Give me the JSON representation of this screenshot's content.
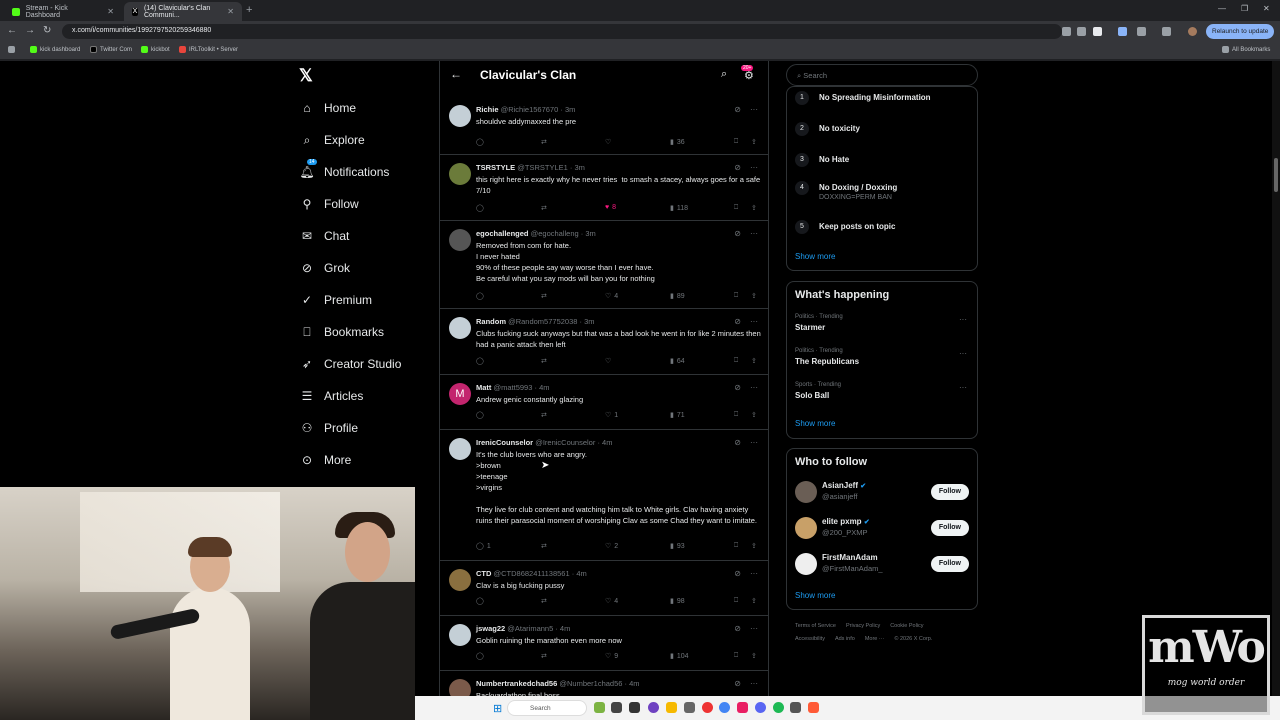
{
  "browser": {
    "tabs": [
      {
        "title": "Stream - Kick Dashboard"
      },
      {
        "title": "(14) Clavicular's Clan Communi..."
      }
    ],
    "url": "x.com/i/communities/1992797520259346880",
    "relaunch_label": "Relaunch to update",
    "bookmarks": [
      "kick dashboard",
      "Twitter Com",
      "kickbot",
      "IRLToolkit • Server"
    ],
    "all_bookmarks_label": "All Bookmarks"
  },
  "sidebar": {
    "notification_count": "14",
    "items": [
      {
        "label": "Home"
      },
      {
        "label": "Explore"
      },
      {
        "label": "Notifications"
      },
      {
        "label": "Follow"
      },
      {
        "label": "Chat"
      },
      {
        "label": "Grok"
      },
      {
        "label": "Premium"
      },
      {
        "label": "Bookmarks"
      },
      {
        "label": "Creator Studio"
      },
      {
        "label": "Articles"
      },
      {
        "label": "Profile"
      },
      {
        "label": "More"
      }
    ]
  },
  "feed": {
    "title": "Clavicular's Clan",
    "header_badge": "20+",
    "tweets": [
      {
        "name": "Richie",
        "handle": "@Richie1567670",
        "time": "· 3m",
        "text": "shouldve addymaxxed the pre",
        "replies": "",
        "likes": "",
        "views": "36"
      },
      {
        "name": "TSRSTYLE",
        "handle": "@TSRSTYLE1",
        "time": "· 3m",
        "text": "this right here is exactly why he never tries  to smash a stacey, always goes for a safe 7/10",
        "replies": "",
        "likes": "8",
        "views": "118"
      },
      {
        "name": "egochallenged",
        "handle": "@egochalleng",
        "time": "· 3m",
        "text": "Removed from com for hate.\nI never hated\n90% of these people say way worse than I ever have.\nBe careful what you say mods will ban you for nothing",
        "replies": "",
        "likes": "4",
        "views": "89"
      },
      {
        "name": "Random",
        "handle": "@Random57752038",
        "time": "· 3m",
        "text": "Clubs fucking suck anyways but that was a bad look he went in for like 2 minutes then had a panic attack then left",
        "replies": "",
        "likes": "",
        "views": "64"
      },
      {
        "name": "Matt",
        "handle": "@matt5993",
        "time": "· 4m",
        "text": "Andrew genic constantly glazing",
        "replies": "",
        "likes": "1",
        "views": "71"
      },
      {
        "name": "IrenicCounselor",
        "handle": "@IrenicCounselor",
        "time": "· 4m",
        "text": "It's the club lovers who are angry.\n>brown\n>teenage\n>virgins\n\nThey live for club content and watching him talk to White girls. Clav having anxiety ruins their parasocial moment of worshiping Clav as some Chad they want to imitate.",
        "replies": "1",
        "likes": "2",
        "views": "93"
      },
      {
        "name": "CTD",
        "handle": "@CTD8682411138561",
        "time": "· 4m",
        "text": "Clav is a big fucking pussy",
        "replies": "",
        "likes": "4",
        "views": "98"
      },
      {
        "name": "jswag22",
        "handle": "@Atarimann5",
        "time": "· 4m",
        "text": "Goblin ruining the marathon even more now",
        "replies": "",
        "likes": "9",
        "views": "104"
      },
      {
        "name": "Numbertrankedchad56",
        "handle": "@Number1chad56",
        "time": "· 4m",
        "text": "Backyardathon final boss",
        "replies": "",
        "likes": "",
        "views": ""
      }
    ]
  },
  "right": {
    "search_placeholder": "Search",
    "rules": [
      {
        "num": "1",
        "title": "No Spreading Misinformation",
        "sub": ""
      },
      {
        "num": "2",
        "title": "No toxicity",
        "sub": ""
      },
      {
        "num": "3",
        "title": "No Hate",
        "sub": ""
      },
      {
        "num": "4",
        "title": "No Doxing / Doxxing",
        "sub": "DOXXING=PERM BAN"
      },
      {
        "num": "5",
        "title": "Keep posts on topic",
        "sub": ""
      }
    ],
    "show_more": "Show more",
    "whats_happening_title": "What's happening",
    "trends": [
      {
        "context": "Politics · Trending",
        "title": "Starmer"
      },
      {
        "context": "Politics · Trending",
        "title": "The Republicans"
      },
      {
        "context": "Sports · Trending",
        "title": "Solo Ball"
      }
    ],
    "who_to_follow_title": "Who to follow",
    "follow_suggestions": [
      {
        "name": "AsianJeff",
        "handle": "@asianjeff",
        "button": "Follow"
      },
      {
        "name": "elite pxmp",
        "handle": "@200_PXMP",
        "button": "Follow"
      },
      {
        "name": "FirstManAdam",
        "handle": "@FirstManAdam_",
        "button": "Follow"
      }
    ],
    "footer_links": [
      "Terms of Service",
      "Privacy Policy",
      "Cookie Policy",
      "Accessibility",
      "Ads info",
      "More ···",
      "© 2026 X Corp."
    ]
  },
  "taskbar": {
    "search_placeholder": "Search"
  },
  "overlay": {
    "logo_text": "mWo",
    "tagline": "mog world order"
  }
}
